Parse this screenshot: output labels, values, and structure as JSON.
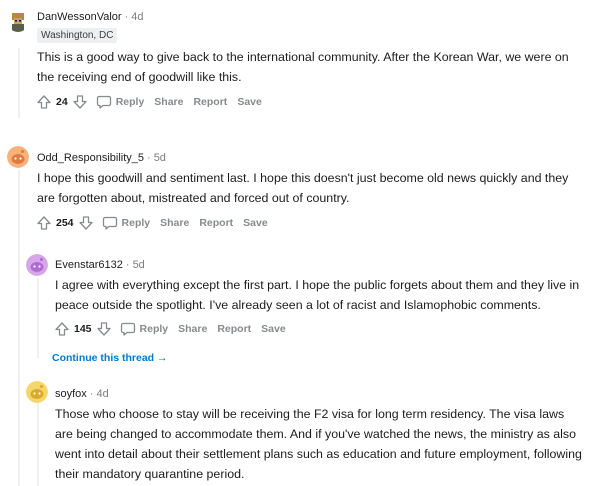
{
  "comments": [
    {
      "username": "DanWessonValor",
      "age": "4d",
      "flair": "Washington, DC",
      "text": "This is a good way to give back to the international community. After the Korean War, we were on the receiving end of goodwill like this.",
      "votes": "24",
      "reply": "Reply",
      "share": "Share",
      "report": "Report",
      "save": "Save"
    },
    {
      "username": "Odd_Responsibility_5",
      "age": "5d",
      "text": "I hope this goodwill and sentiment last. I hope this doesn't just become old news quickly and they are forgotten about, mistreated and forced out of country.",
      "votes": "254",
      "reply": "Reply",
      "share": "Share",
      "report": "Report",
      "save": "Save"
    },
    {
      "username": "Evenstar6132",
      "age": "5d",
      "text": "I agree with everything except the first part. I hope the public forgets about them and they live in peace outside the spotlight. I've already seen a lot of racist and Islamophobic comments.",
      "votes": "145",
      "reply": "Reply",
      "share": "Share",
      "report": "Report",
      "save": "Save"
    },
    {
      "username": "soyfox",
      "age": "4d",
      "text": "Those who choose to stay will be receiving the F2 visa for long term residency. The visa laws are being changed to accommodate them. And if you've watched the news, the ministry as also went into detail about their settlement plans such as education and future employment, following their mandatory quarantine period."
    }
  ],
  "continue_thread": "Continue this thread →",
  "dot": "·",
  "colors": {
    "link": "#0079d3",
    "meta": "#7c7c7c",
    "action": "#878a8c",
    "thread_line": "#edeff1"
  }
}
